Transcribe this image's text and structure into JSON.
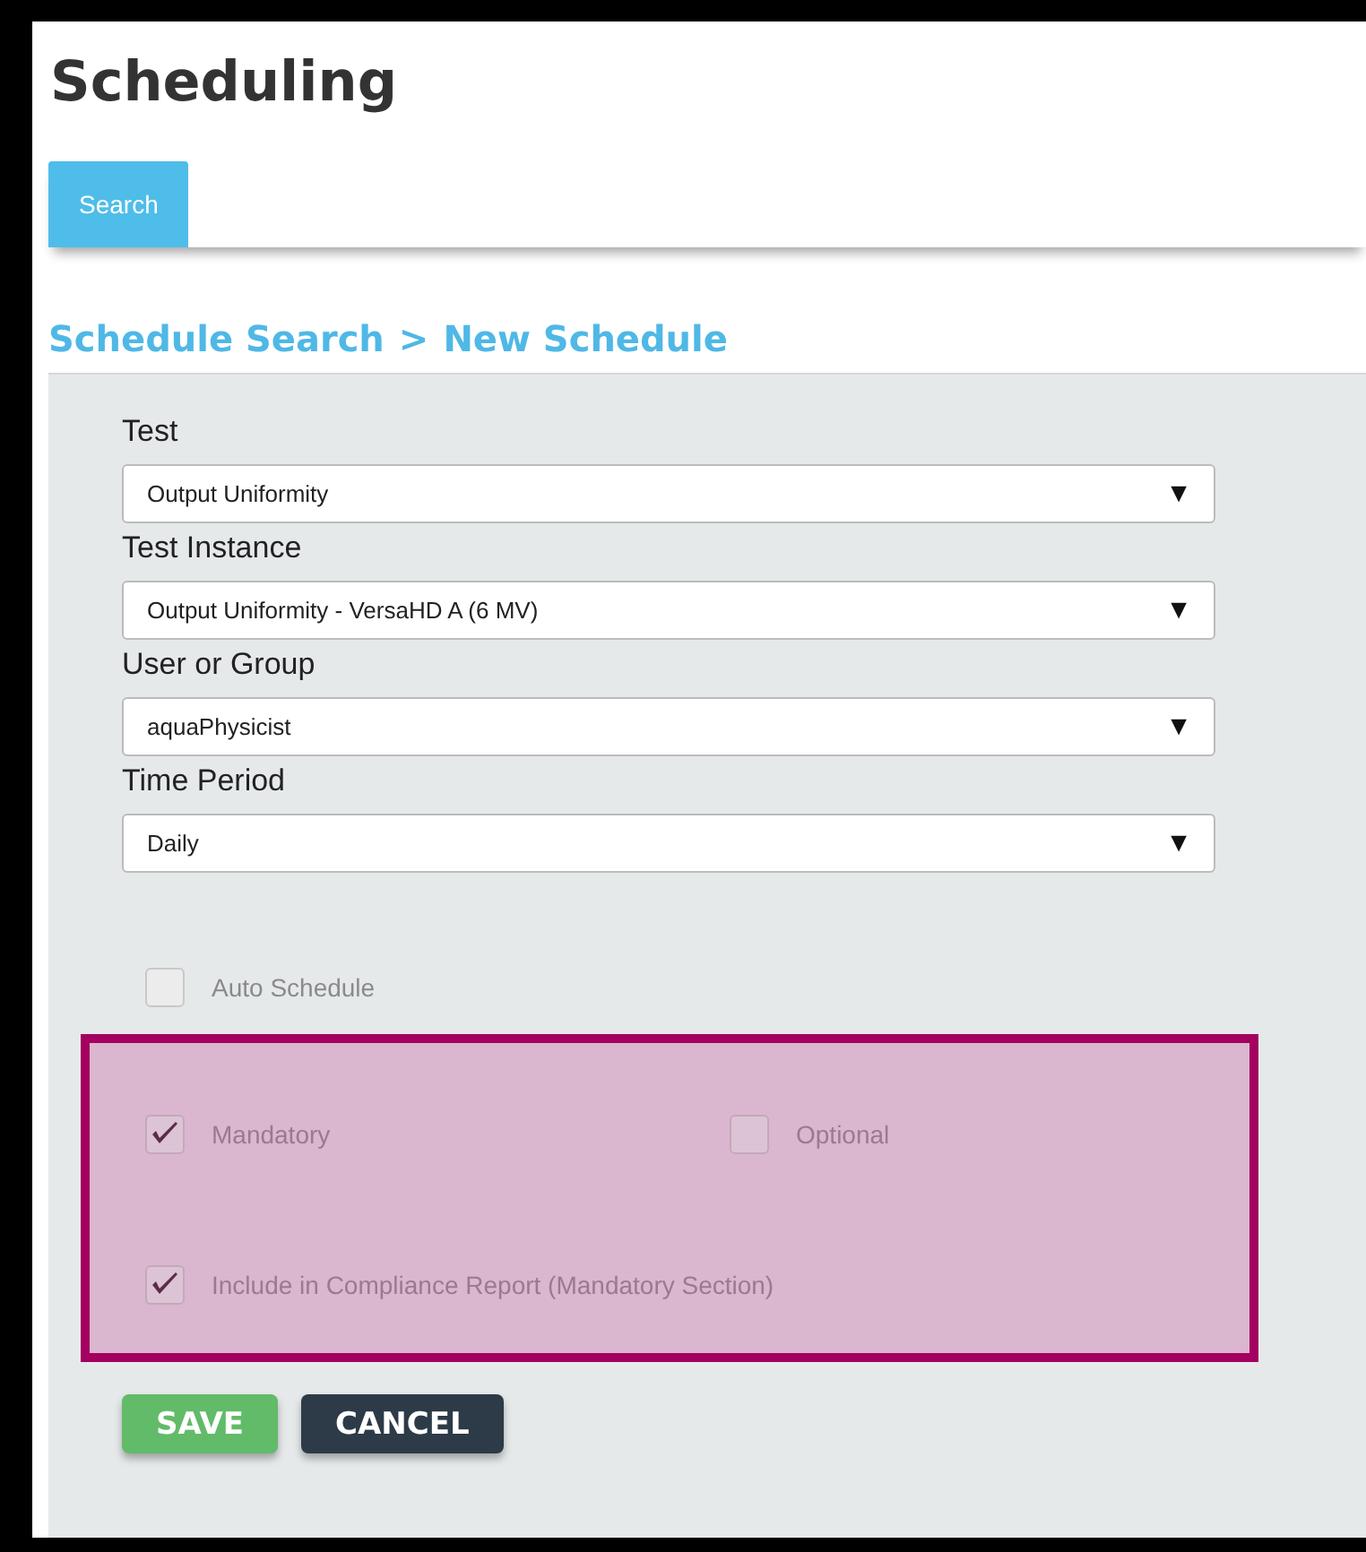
{
  "page_title": "Scheduling",
  "tabs": [
    {
      "label": "Search",
      "selected": true
    }
  ],
  "breadcrumb": {
    "items": [
      "Schedule Search",
      "New Schedule"
    ],
    "separator": ">"
  },
  "fields": [
    {
      "label": "Test",
      "value": "Output Uniformity"
    },
    {
      "label": "Test Instance",
      "value": "Output Uniformity - VersaHD A (6 MV)"
    },
    {
      "label": "User or Group",
      "value": "aquaPhysicist"
    },
    {
      "label": "Time Period",
      "value": "Daily"
    }
  ],
  "dropdown_arrow": "▼",
  "auto_schedule": {
    "label": "Auto Schedule",
    "checked": false
  },
  "highlighted_group": {
    "rows": [
      [
        {
          "label": "Mandatory",
          "checked": true
        },
        {
          "label": "Optional",
          "checked": false
        }
      ],
      [
        {
          "label": "Include in Compliance Report (Mandatory Section)",
          "checked": true
        }
      ]
    ]
  },
  "buttons": [
    {
      "label": "SAVE",
      "kind": "primary"
    },
    {
      "label": "CANCEL",
      "kind": "secondary"
    }
  ]
}
